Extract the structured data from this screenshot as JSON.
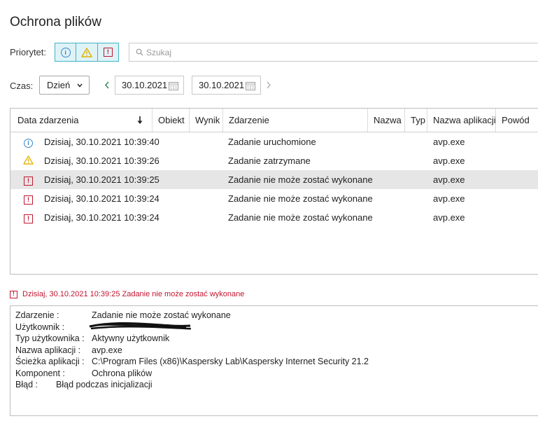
{
  "title": "Ochrona plików",
  "filters": {
    "priority_label": "Priorytet:",
    "search_placeholder": "Szukaj",
    "time_label": "Czas:",
    "period": "Dzień",
    "date_from": "30.10.2021",
    "date_to": "30.10.2021"
  },
  "columns": [
    "Data zdarzenia",
    "Obiekt",
    "Wynik",
    "Zdarzenie",
    "Nazwa",
    "Typ",
    "Nazwa aplikacji",
    "Powód"
  ],
  "rows": [
    {
      "icon": "info-icon",
      "date": "Dzisiaj, 30.10.2021 10:39:40",
      "event": "Zadanie uruchomione",
      "app": "avp.exe"
    },
    {
      "icon": "warning-icon",
      "date": "Dzisiaj, 30.10.2021 10:39:26",
      "event": "Zadanie zatrzymane",
      "app": "avp.exe"
    },
    {
      "icon": "error-icon",
      "date": "Dzisiaj, 30.10.2021 10:39:25",
      "event": "Zadanie nie może zostać wykonane",
      "app": "avp.exe"
    },
    {
      "icon": "error-icon",
      "date": "Dzisiaj, 30.10.2021 10:39:24",
      "event": "Zadanie nie może zostać wykonane",
      "app": "avp.exe"
    },
    {
      "icon": "error-icon",
      "date": "Dzisiaj, 30.10.2021 10:39:24",
      "event": "Zadanie nie może zostać wykonane",
      "app": "avp.exe"
    }
  ],
  "selected_event": "Dzisiaj, 30.10.2021 10:39:25 Zadanie nie może zostać wykonane",
  "details": [
    {
      "key": "Zdarzenie :",
      "value": "Zadanie nie może zostać wykonane"
    },
    {
      "key": "Użytkownik :",
      "value": ""
    },
    {
      "key": "Typ użytkownika :",
      "value": "Aktywny użytkownik"
    },
    {
      "key": "Nazwa aplikacji :",
      "value": "avp.exe"
    },
    {
      "key": "Ścieżka aplikacji :",
      "value": "C:\\Program Files (x86)\\Kaspersky Lab\\Kaspersky Internet Security 21.2"
    },
    {
      "key": "Komponent :",
      "value": "Ochrona plików"
    },
    {
      "key": "Błąd :",
      "value": "Błąd podczas inicjalizacji"
    }
  ],
  "colors": {
    "accent": "#3fb4c9",
    "error": "#c0152f",
    "info": "#3a86c8",
    "warning": "#e0b200",
    "selected_row": "#e6e6e6"
  }
}
